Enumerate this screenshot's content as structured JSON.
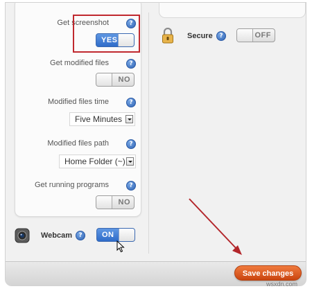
{
  "settings": {
    "get_screenshot": {
      "label": "Get screenshot",
      "state": "YES"
    },
    "get_modified_files": {
      "label": "Get modified files",
      "state": "NO"
    },
    "modified_files_time": {
      "label": "Modified files time",
      "value": "Five Minutes"
    },
    "modified_files_path": {
      "label": "Modified files path",
      "value": "Home Folder (~)"
    },
    "get_running_programs": {
      "label": "Get running programs",
      "state": "NO"
    }
  },
  "webcam": {
    "label": "Webcam",
    "state": "ON"
  },
  "secure": {
    "label": "Secure",
    "state": "OFF"
  },
  "help_glyph": "?",
  "save_label": "Save changes",
  "watermark": "wsxdn.com",
  "colors": {
    "toggle_on": "#3a78d6",
    "save_button": "#e0581f",
    "highlight_box": "#c0282e",
    "arrow": "#b3262b"
  }
}
